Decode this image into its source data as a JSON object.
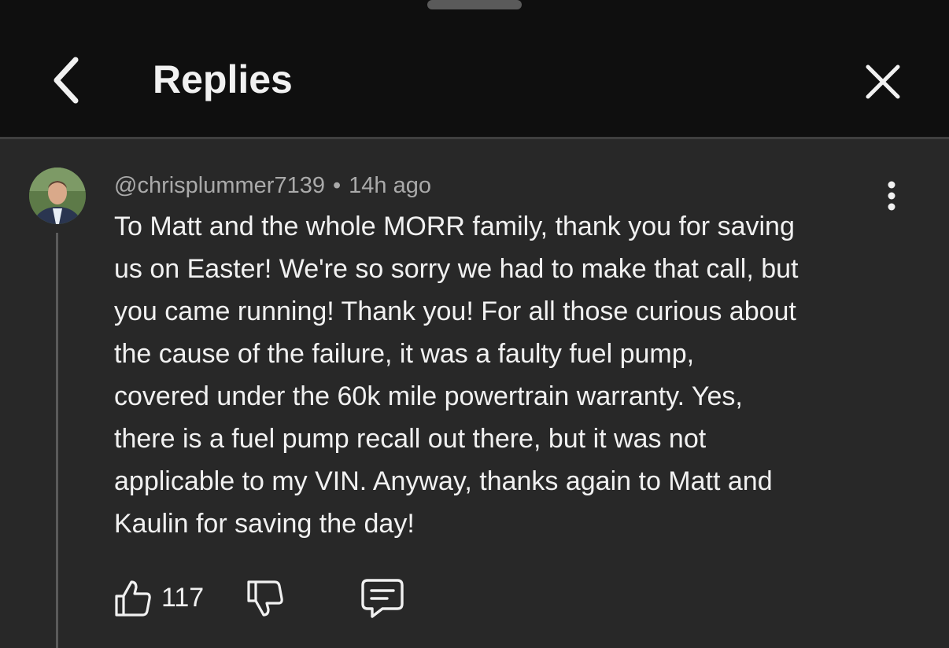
{
  "header": {
    "title": "Replies"
  },
  "comment": {
    "author": "@chrisplummer7139",
    "separator": "•",
    "time": "14h ago",
    "text": "To Matt and the whole MORR family, thank you for saving\nus on Easter! We're so sorry we had to make that call, but\nyou came running! Thank you! For all those curious about\nthe cause of the failure, it was a faulty fuel pump,\ncovered under the 60k mile powertrain warranty. Yes,\nthere is a fuel pump recall out there, but it was not\napplicable to my VIN. Anyway, thanks again to Matt and\nKaulin for saving the day!",
    "like_count": "117"
  },
  "icons": {
    "back": "chevron-left-icon",
    "close": "close-icon",
    "more": "more-vertical-icon",
    "like": "thumbs-up-icon",
    "dislike": "thumbs-down-icon",
    "reply": "comment-icon"
  },
  "colors": {
    "background": "#282828",
    "header_background": "#0f0f0f",
    "text_primary": "#f1f1f1",
    "text_secondary": "#aaaaaa"
  }
}
